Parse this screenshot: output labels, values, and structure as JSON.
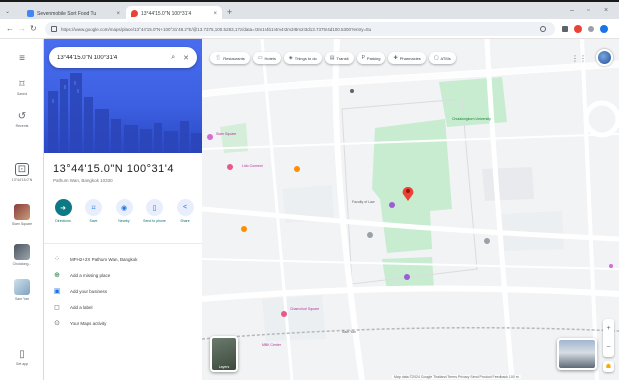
{
  "tabs": [
    {
      "title": "Sevenmobile Sort Food Tu",
      "favicon_color": "#4285f4"
    },
    {
      "title": "13°44'15.0\"N 100°31'4",
      "favicon_color": "#ea4335"
    }
  ],
  "omnibox": {
    "url": "https://www.google.com/maps/place/13°44'15.0\"N+100°31'48.2\"E/@13.7375,100.5283,17z/data=!3m1!4b1!4m4!3m3!8m2!3d13.7375!4d100.5300?entry=ttu"
  },
  "rail": [
    {
      "label": "Menu",
      "icon": "menu-icon",
      "glyph": "≡"
    },
    {
      "label": "Saved",
      "icon": "bookmark-icon",
      "glyph": "⌑"
    },
    {
      "label": "Recents",
      "icon": "history-icon",
      "glyph": "↺"
    },
    {
      "label": "13°44'15.0\"N",
      "icon": "pin-icon",
      "glyph": "⊡"
    },
    {
      "label": "Siam Square",
      "icon": "thumb",
      "glyph": ""
    },
    {
      "label": "Chulalong...",
      "icon": "thumb",
      "glyph": ""
    },
    {
      "label": "Sam Yan",
      "icon": "thumb",
      "glyph": ""
    },
    {
      "label": "Get app",
      "icon": "phone-icon",
      "glyph": "▯"
    }
  ],
  "search": {
    "value": "13°44'15.0\"N 100°31'4"
  },
  "place": {
    "title": "13°44'15.0\"N 100°31'4",
    "subtitle": "Pathum Wan, Bangkok 10330"
  },
  "actions": [
    {
      "label": "Directions",
      "glyph": "➜",
      "primary": true
    },
    {
      "label": "Save",
      "glyph": "⌑"
    },
    {
      "label": "Nearby",
      "glyph": "◉"
    },
    {
      "label": "Send to phone",
      "glyph": "▯"
    },
    {
      "label": "Share",
      "glyph": "<"
    }
  ],
  "list": [
    {
      "text": "MFH2+2X Pathum Wan, Bangkok",
      "icon": "plus-code-icon",
      "glyph": "⁘",
      "color": ""
    },
    {
      "text": "Add a missing place",
      "icon": "add-place-icon",
      "glyph": "⊕",
      "color": "green"
    },
    {
      "text": "Add your business",
      "icon": "business-icon",
      "glyph": "▣",
      "color": "blue"
    },
    {
      "text": "Add a label",
      "icon": "label-icon",
      "glyph": "◻",
      "color": ""
    },
    {
      "text": "Your Maps activity",
      "icon": "activity-icon",
      "glyph": "⊙",
      "color": ""
    }
  ],
  "chips": [
    {
      "label": "Restaurants",
      "glyph": "🍴"
    },
    {
      "label": "Hotels",
      "glyph": "▭"
    },
    {
      "label": "Things to do",
      "glyph": "◈"
    },
    {
      "label": "Transit",
      "glyph": "▤"
    },
    {
      "label": "Parking",
      "glyph": "P"
    },
    {
      "label": "Pharmacies",
      "glyph": "✚"
    },
    {
      "label": "ATMs",
      "glyph": "▢"
    }
  ],
  "map": {
    "labels": [
      {
        "text": "Chulalongkorn University",
        "color": "#188038"
      },
      {
        "text": "Faculty of Law",
        "color": "#5f6368"
      },
      {
        "text": "Siam Square",
        "color": "#b0369c"
      },
      {
        "text": "Sam Yan",
        "color": "#5f6368"
      },
      {
        "text": "Chamchuri Square",
        "color": "#b0369c"
      },
      {
        "text": "MBK Center",
        "color": "#b0369c"
      },
      {
        "text": "Lido Connect",
        "color": "#b0369c"
      }
    ],
    "layers_label": "Layers",
    "footer": "Map data ©2024 Google  Thailand  Terms  Privacy  Send Product Feedback  100 m"
  }
}
